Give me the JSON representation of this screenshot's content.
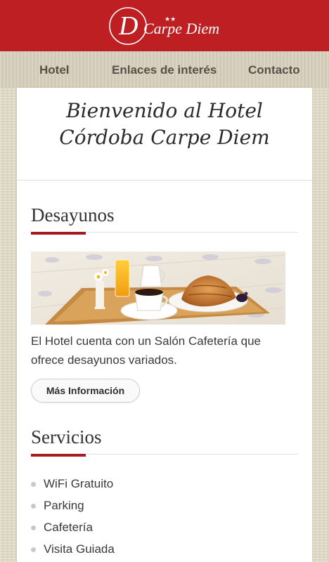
{
  "header": {
    "logo_letter": "D",
    "logo_text": "Carpe Diem",
    "logo_stars": "★★",
    "brand_color": "#be1f22"
  },
  "nav": {
    "items": [
      {
        "label": "Hotel"
      },
      {
        "label": "Enlaces de interés"
      },
      {
        "label": "Contacto"
      }
    ]
  },
  "main": {
    "welcome_line1": "Bienvenido al Hotel",
    "welcome_line2": "Córdoba Carpe Diem",
    "breakfast": {
      "title": "Desayunos",
      "desc_line1": "El Hotel cuenta con un Salón Cafetería que",
      "desc_line2": "ofrece desayunos variados.",
      "button_label": "Más Información",
      "image_name": "breakfast-tray-photo"
    },
    "services": {
      "title": "Servicios",
      "items": [
        "WiFi Gratuito",
        "Parking",
        "Cafetería",
        "Visita Guiada"
      ]
    }
  },
  "colors": {
    "accent": "#a61b1e",
    "background": "#e3dcc9"
  }
}
